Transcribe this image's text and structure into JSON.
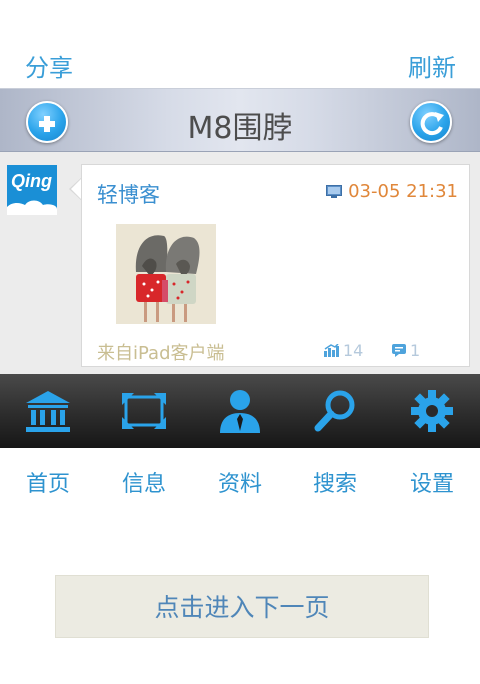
{
  "header": {
    "share_label": "分享",
    "refresh_label": "刷新",
    "title": "M8围脖"
  },
  "post": {
    "avatar_logo_text": "Qing",
    "author": "轻博客",
    "time": "03-05 21:31",
    "source": "来自iPad客户端",
    "repost_count": "14",
    "comment_count": "1"
  },
  "tabs": [
    {
      "label": "首页",
      "icon": "bank-icon"
    },
    {
      "label": "信息",
      "icon": "frame-icon"
    },
    {
      "label": "资料",
      "icon": "person-icon"
    },
    {
      "label": "搜索",
      "icon": "search-icon"
    },
    {
      "label": "设置",
      "icon": "gear-icon"
    }
  ],
  "next_page_label": "点击进入下一页",
  "colors": {
    "accent_blue": "#2aa3ea",
    "link_blue": "#3a9ed8",
    "time_orange": "#e0873a",
    "source_tan": "#c9be92"
  }
}
